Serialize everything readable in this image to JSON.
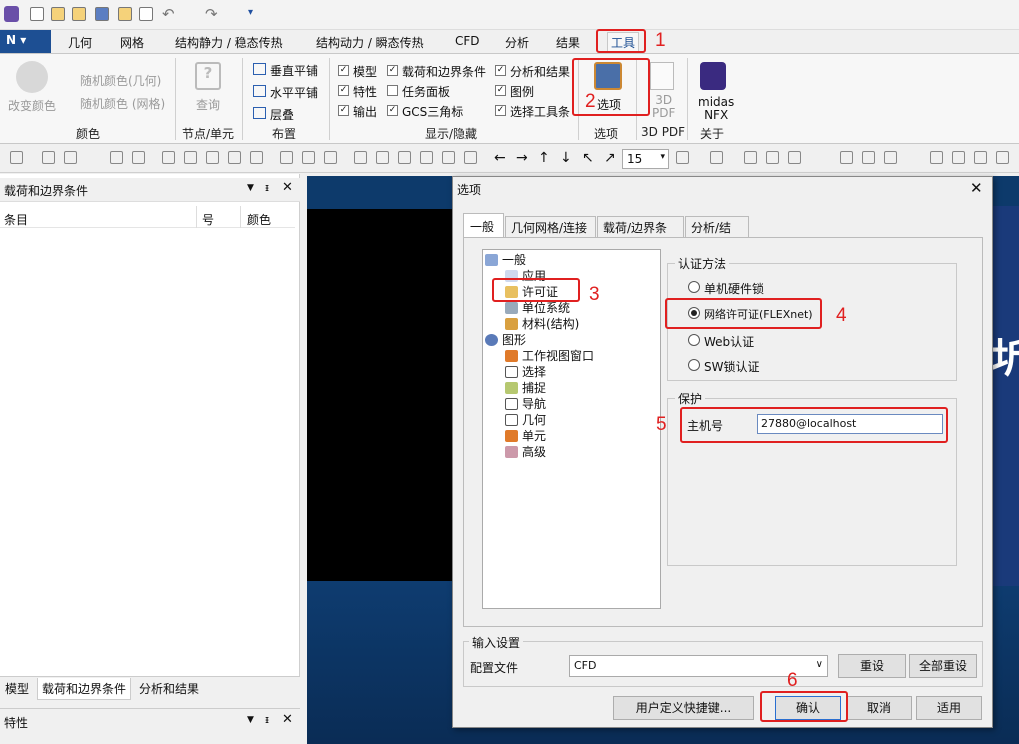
{
  "ribbon_tabs": {
    "geometry": "几何",
    "mesh": "网格",
    "static": "结构静力 / 稳态传热",
    "dynamic": "结构动力 / 瞬态传热",
    "cfd": "CFD",
    "analysis": "分析",
    "results": "结果",
    "tools": "工具"
  },
  "ribbon": {
    "color_group": {
      "change_color": "改变颜色",
      "random_geom": "随机颜色(几何)",
      "random_mesh": "随机颜色 (网格)",
      "label": "颜色"
    },
    "node_group": {
      "query": "查询",
      "label": "节点/单元"
    },
    "layout_group": {
      "vtile": "垂直平铺",
      "htile": "水平平铺",
      "cascade": "层叠",
      "label": "布置"
    },
    "display_group": {
      "model": "模型",
      "loads": "载荷和边界条件",
      "analysis": "分析和结果",
      "props": "特性",
      "taskpane": "任务面板",
      "legend": "图例",
      "output": "输出",
      "gcs": "GCS三角标",
      "select_toolbar": "选择工具条",
      "label": "显示/隐藏"
    },
    "options_group": {
      "options": "选项",
      "label": "选项"
    },
    "pdf_group": {
      "pdf": "3D\nPDF",
      "label": "3D PDF"
    },
    "about_group": {
      "nfx": "midas\nNFX",
      "label": "关于"
    }
  },
  "toolbar": {
    "zoom_value": "15"
  },
  "left_panel": {
    "title": "载荷和边界条件",
    "col_item": "条目",
    "col_num": "号",
    "col_color": "颜色",
    "bottom_tabs": {
      "model": "模型",
      "loads": "载荷和边界条件",
      "results": "分析和结果"
    },
    "props_title": "特性"
  },
  "dialog": {
    "title": "选项",
    "tabs": {
      "general": "一般",
      "geometry": "几何网格/连接",
      "loads": "载荷/边界条件",
      "analysis": "分析/结果"
    },
    "tree": {
      "general": "一般",
      "application": "应用",
      "license": "许可证",
      "units": "单位系统",
      "material": "材料(结构)",
      "graphics": "图形",
      "work_view": "工作视图窗口",
      "select": "选择",
      "snap": "捕捉",
      "nav": "导航",
      "geom": "几何",
      "element": "单元",
      "advanced": "高级"
    },
    "auth": {
      "legend": "认证方法",
      "opt1": "单机硬件锁",
      "opt2": "网络许可证(FLEXnet)",
      "opt3": "Web认证",
      "opt4": "SW锁认证"
    },
    "protect": {
      "legend": "保护",
      "host_label": "主机号",
      "host_value": "27880@localhost"
    },
    "input": {
      "legend": "输入设置",
      "profile_label": "配置文件",
      "profile_value": "CFD",
      "reset": "重设",
      "reset_all": "全部重设"
    },
    "buttons": {
      "shortcut": "用户定义快捷键...",
      "ok": "确认",
      "cancel": "取消",
      "apply": "适用"
    }
  },
  "annotations": {
    "n1": "1",
    "n2": "2",
    "n3": "3",
    "n4": "4",
    "n5": "5",
    "n6": "6"
  },
  "viewport_glyph": "圻"
}
